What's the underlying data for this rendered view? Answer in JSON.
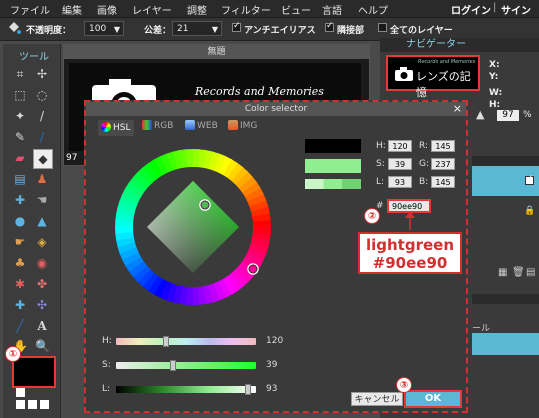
{
  "menubar": {
    "items": [
      "ファイル",
      "編集",
      "画像",
      "レイヤー",
      "調整",
      "フィルター",
      "ビュー",
      "言語",
      "ヘルプ"
    ],
    "login": "ログイン",
    "separator": "|",
    "signup": "サインアップ"
  },
  "options": {
    "opacity_label": "不透明度：",
    "opacity_value": "100",
    "tolerance_label": "公差：",
    "tolerance_value": "21",
    "antialias_label": "アンチエイリアス",
    "contiguous_label": "隣接部",
    "all_layers_label": "全てのレイヤー"
  },
  "toolbox": {
    "title": "ツール"
  },
  "document": {
    "title": "無題",
    "image_text": "Records and Memories",
    "zoom": "97"
  },
  "navigator": {
    "title": "ナビゲーター",
    "logo_small": "Records and Memories",
    "logo_text": "レンズの記憶",
    "x_label": "X:",
    "y_label": "Y:",
    "w_label": "W:",
    "h_label": "H:",
    "zoom_value": "97",
    "zoom_unit": "%",
    "layer_hint": "ール"
  },
  "dialog": {
    "title": "Color selector",
    "tabs": [
      "HSL",
      "RGB",
      "WEB",
      "IMG"
    ],
    "fields": {
      "h_label": "H:",
      "h_value": "120",
      "s_label": "S:",
      "s_value": "39",
      "l_label": "L:",
      "l_value": "93",
      "r_label": "R:",
      "r_value": "145",
      "g_label": "G:",
      "g_value": "237",
      "b_label": "B:",
      "b_value": "145",
      "hex_label": "#",
      "hex_value": "90ee90"
    },
    "sliders": {
      "h_label": "H:",
      "h_value": "120",
      "s_label": "S:",
      "s_value": "39",
      "l_label": "L:",
      "l_value": "93"
    },
    "cancel_label": "キャンセル",
    "ok_label": "OK"
  },
  "annotations": {
    "badge1": "①",
    "badge2": "②",
    "badge3": "③",
    "callout_line1": "lightgreen",
    "callout_line2": "#90ee90"
  },
  "colors": {
    "selected": "#90ee90",
    "previous": "#000000",
    "accent": "#5bb8d4",
    "annotation": "#d32f2f"
  },
  "values": {
    "hue_deg": 120,
    "saturation_pct": 39,
    "lightness_pct": 93
  }
}
